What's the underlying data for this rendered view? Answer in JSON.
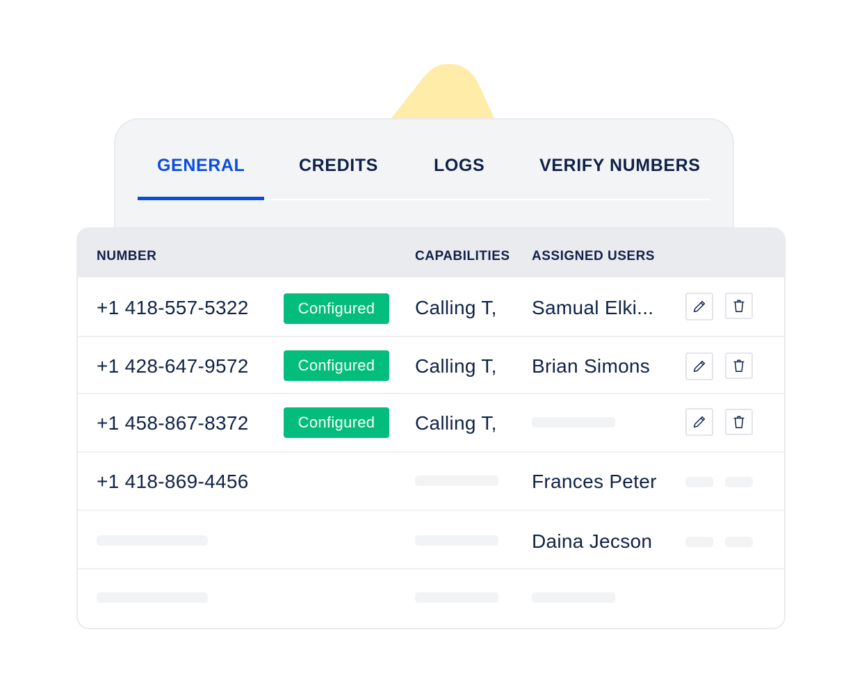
{
  "colors": {
    "accent": "#0b4ce0",
    "text": "#0f2147",
    "badge_bg": "#02bd7c",
    "decor": "#feeca8"
  },
  "tabs": [
    {
      "label": "GENERAL",
      "active": true
    },
    {
      "label": "CREDITS",
      "active": false
    },
    {
      "label": "LOGS",
      "active": false
    },
    {
      "label": "VERIFY NUMBERS",
      "active": false
    }
  ],
  "table": {
    "columns": [
      "NUMBER",
      "CAPABILITIES",
      "ASSIGNED USERS"
    ],
    "rows": [
      {
        "number": "+1 418-557-5322",
        "status": "Configured",
        "capabilities": "Calling T,",
        "user": "Samual Elki...",
        "actions": [
          "pencil-icon",
          "trash-icon"
        ]
      },
      {
        "number": "+1 428-647-9572",
        "status": "Configured",
        "capabilities": "Calling T,",
        "user": "Brian Simons",
        "actions": [
          "pencil-icon",
          "trash-icon"
        ]
      },
      {
        "number": "+1 458-867-8372",
        "status": "Configured",
        "capabilities": "Calling T,",
        "user": null,
        "actions": [
          "pencil-icon",
          "trash-icon"
        ]
      },
      {
        "number": "+1 418-869-4456",
        "status": null,
        "capabilities": null,
        "user": "Frances Peter",
        "actions": null
      },
      {
        "number": null,
        "status": null,
        "capabilities": null,
        "user": "Daina Jecson",
        "actions": null
      },
      {
        "number": null,
        "status": null,
        "capabilities": null,
        "user": null,
        "actions": null
      }
    ]
  }
}
